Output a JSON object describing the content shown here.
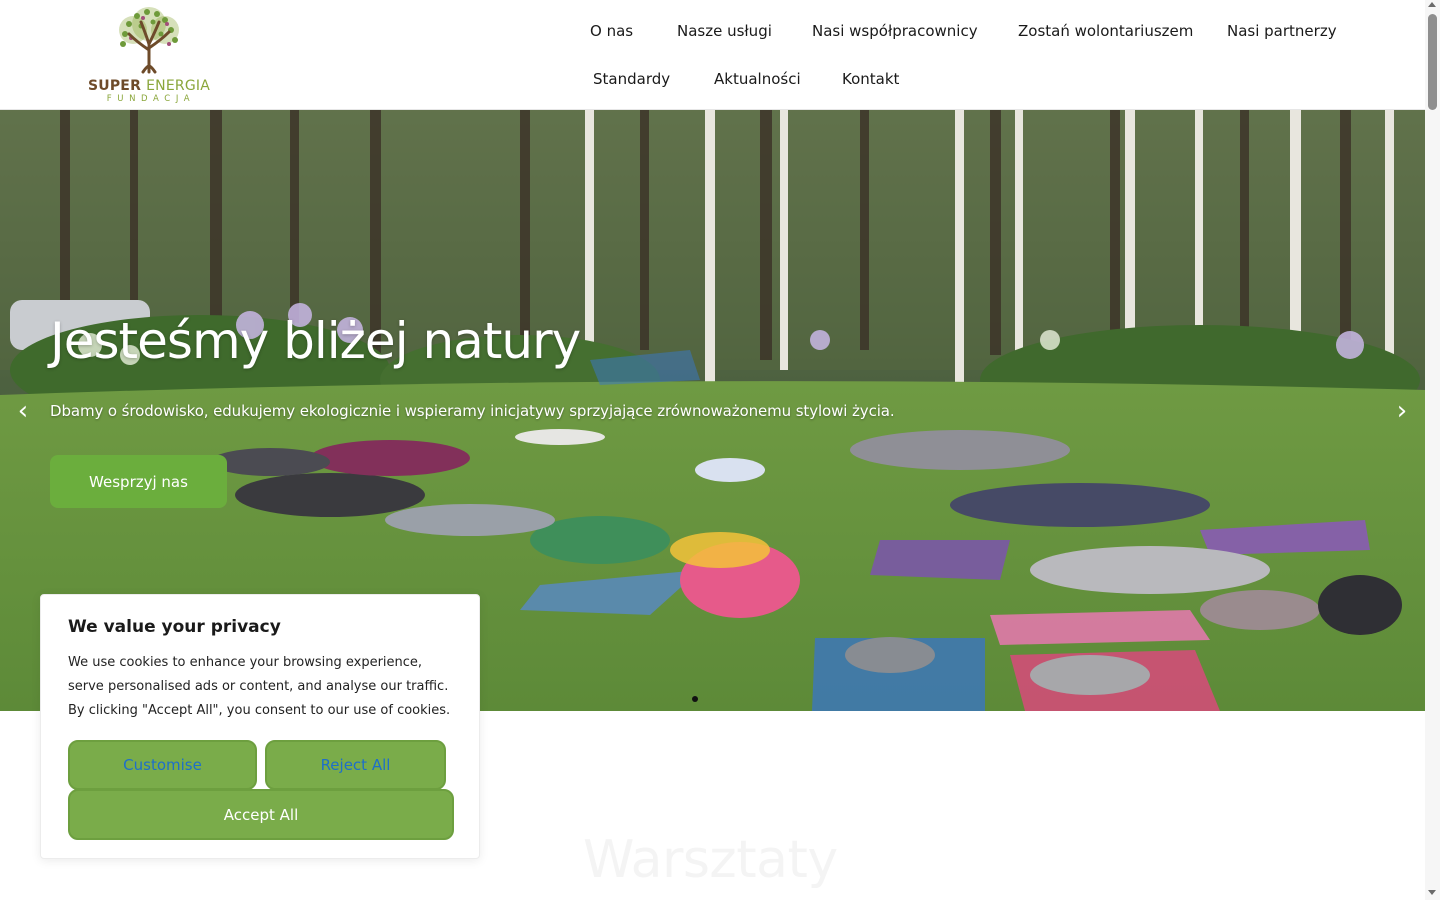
{
  "logo": {
    "line1_a": "SUPER",
    "line1_b": "ENERGIA",
    "line2": "FUNDACJA"
  },
  "nav": {
    "items": [
      "O nas",
      "Nasze usługi",
      "Nasi współpracownicy",
      "Zostań wolontariuszem",
      "Nasi partnerzy",
      "Standardy",
      "Aktualności",
      "Kontakt"
    ]
  },
  "hero": {
    "title": "Jesteśmy bliżej natury",
    "subtitle": "Dbamy o środowisko, edukujemy ekologicznie i wspieramy inicjatywy sprzyjające zrównoważonemu stylowi życia.",
    "button": "Wesprzyj nas",
    "prev_icon": "chevron-left-icon",
    "next_icon": "chevron-right-icon",
    "prev_glyph": "‹",
    "next_glyph": "›"
  },
  "section": {
    "title": "Warsztaty"
  },
  "cookie": {
    "title": "We value your privacy",
    "text": "We use cookies to enhance your browsing experience, serve personalised ads or content, and analyse our traffic. By clicking \"Accept All\", you consent to our use of cookies.",
    "customise": "Customise",
    "reject": "Reject All",
    "accept": "Accept All"
  },
  "colors": {
    "accent_green": "#6bae3d",
    "cookie_button_green": "#7aac4a",
    "cookie_link_blue": "#1e6fc9",
    "logo_brown": "#6e4b2a",
    "logo_green": "#8aa63a"
  }
}
